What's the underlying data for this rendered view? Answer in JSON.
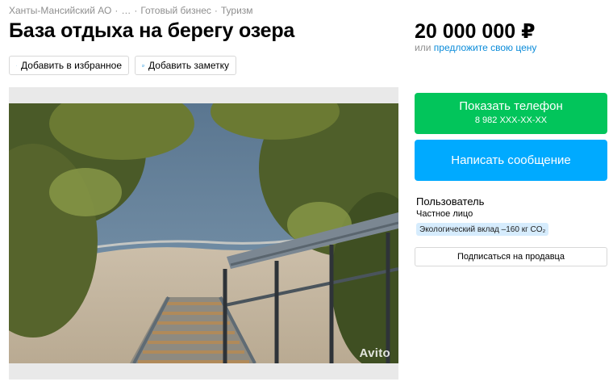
{
  "breadcrumb": {
    "items": [
      "Ханты-Мансийский АО",
      "…",
      "Готовый бизнес",
      "Туризм"
    ],
    "separator": "·"
  },
  "listing": {
    "title": "База отдыха на берегу озера"
  },
  "price": {
    "amount": "20 000 000 ₽",
    "or_text": "или",
    "offer_link": "предложите свою цену"
  },
  "actions": {
    "favorite_label": "Добавить в избранное",
    "note_label": "Добавить заметку"
  },
  "gallery": {
    "watermark": "Avito"
  },
  "contact": {
    "show_phone_label": "Показать телефон",
    "phone_masked": "8 982 XXX-XX-XX",
    "message_label": "Написать сообщение"
  },
  "seller": {
    "name": "Пользователь",
    "type": "Частное лицо",
    "eco_badge": "Экологический вклад –160 кг CO₂",
    "subscribe_label": "Подписаться на продавца"
  },
  "colors": {
    "green_button": "#02c55b",
    "blue_button": "#00aaff",
    "link": "#0a8bd9",
    "badge_bg": "#d6ecfd"
  }
}
